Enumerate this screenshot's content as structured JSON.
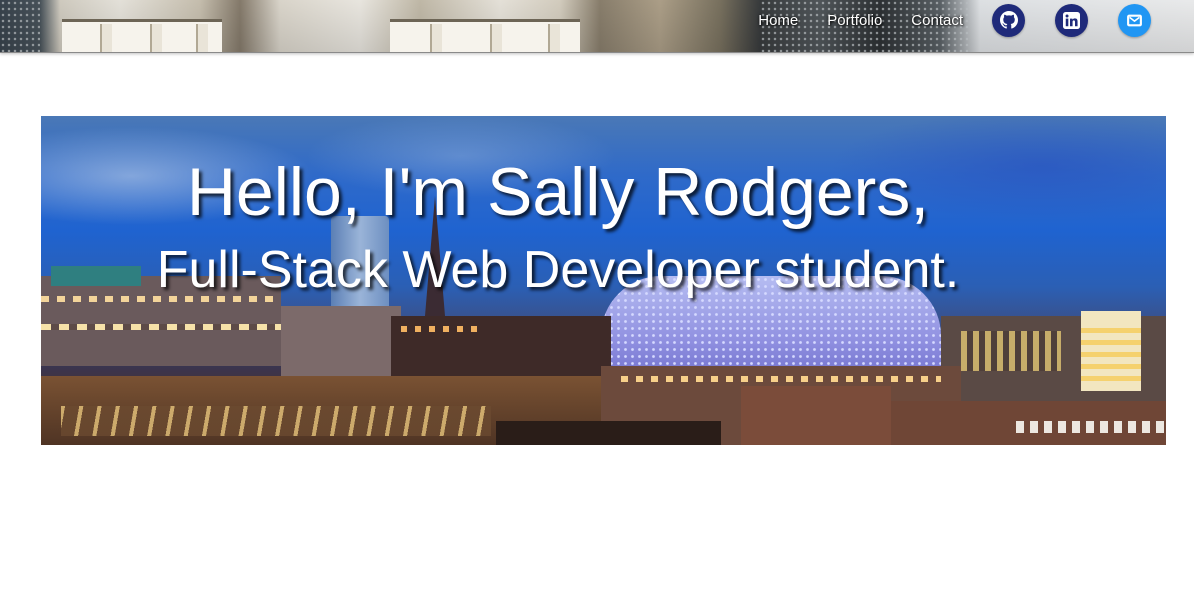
{
  "nav": {
    "links": [
      {
        "label": "Home"
      },
      {
        "label": "Portfolio"
      },
      {
        "label": "Contact"
      }
    ],
    "social": [
      {
        "name": "github",
        "icon": "github-icon",
        "color": "#1f2a7a"
      },
      {
        "name": "linkedin",
        "icon": "linkedin-icon",
        "color": "#1f2a7a"
      },
      {
        "name": "email",
        "icon": "email-icon",
        "color": "#2196f3"
      }
    ]
  },
  "hero": {
    "title": "Hello, I'm Sally Rodgers,",
    "subtitle": "Full-Stack Web Developer student."
  }
}
